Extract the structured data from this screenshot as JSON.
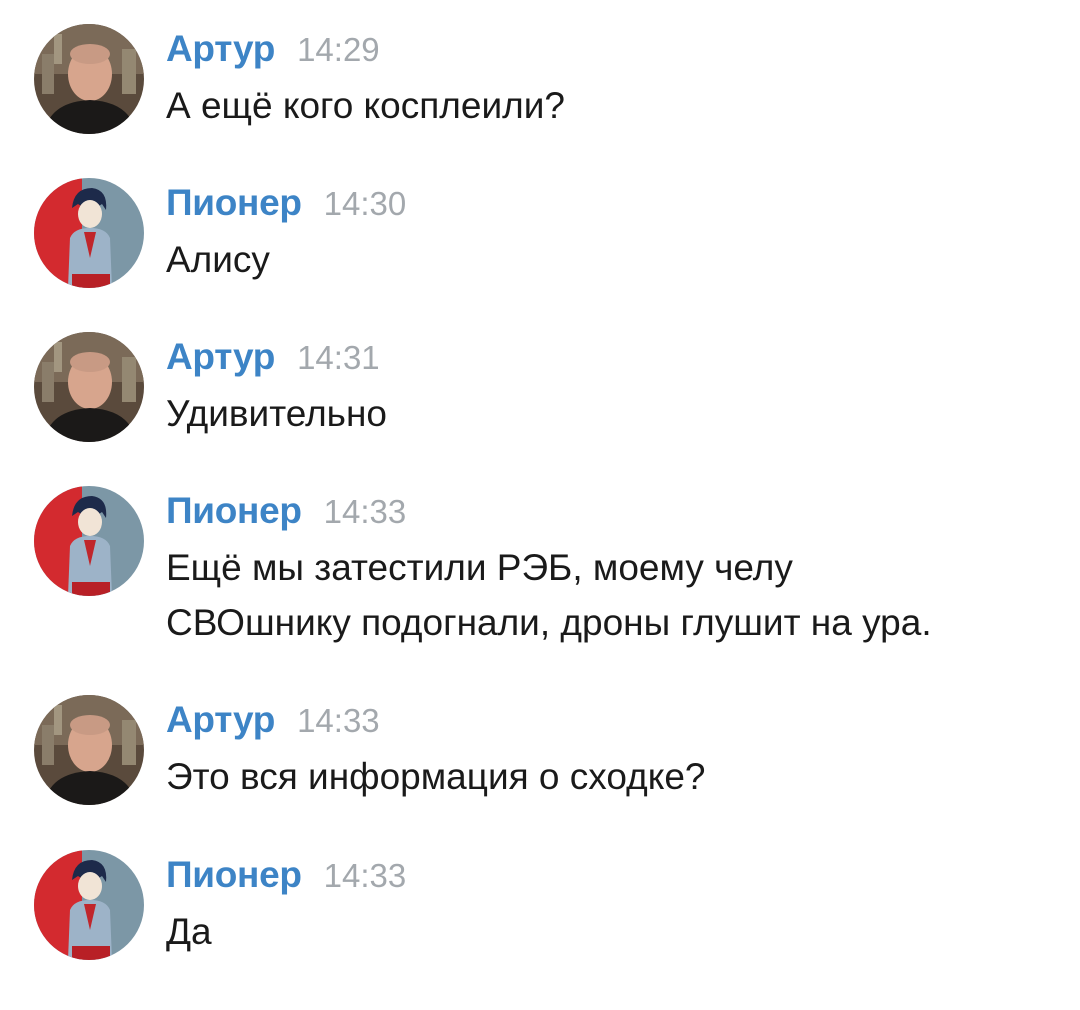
{
  "colors": {
    "author_name": "#3d84c6",
    "timestamp": "#a3a8ad",
    "message_text": "#1a1a1a",
    "background": "#ffffff"
  },
  "messages": [
    {
      "author": "Артур",
      "time": "14:29",
      "text": "А ещё кого косплеили?",
      "avatar": "man-photo-avatar"
    },
    {
      "author": "Пионер",
      "time": "14:30",
      "text": "Алису",
      "avatar": "pioneer-avatar"
    },
    {
      "author": "Артур",
      "time": "14:31",
      "text": "Удивительно",
      "avatar": "man-photo-avatar"
    },
    {
      "author": "Пионер",
      "time": "14:33",
      "text": "Ещё мы затестили РЭБ, моему челу\nСВОшнику подогнали, дроны глушит на ура.",
      "avatar": "pioneer-avatar"
    },
    {
      "author": "Артур",
      "time": "14:33",
      "text": "Это вся информация о сходке?",
      "avatar": "man-photo-avatar"
    },
    {
      "author": "Пионер",
      "time": "14:33",
      "text": "Да",
      "avatar": "pioneer-avatar"
    }
  ]
}
